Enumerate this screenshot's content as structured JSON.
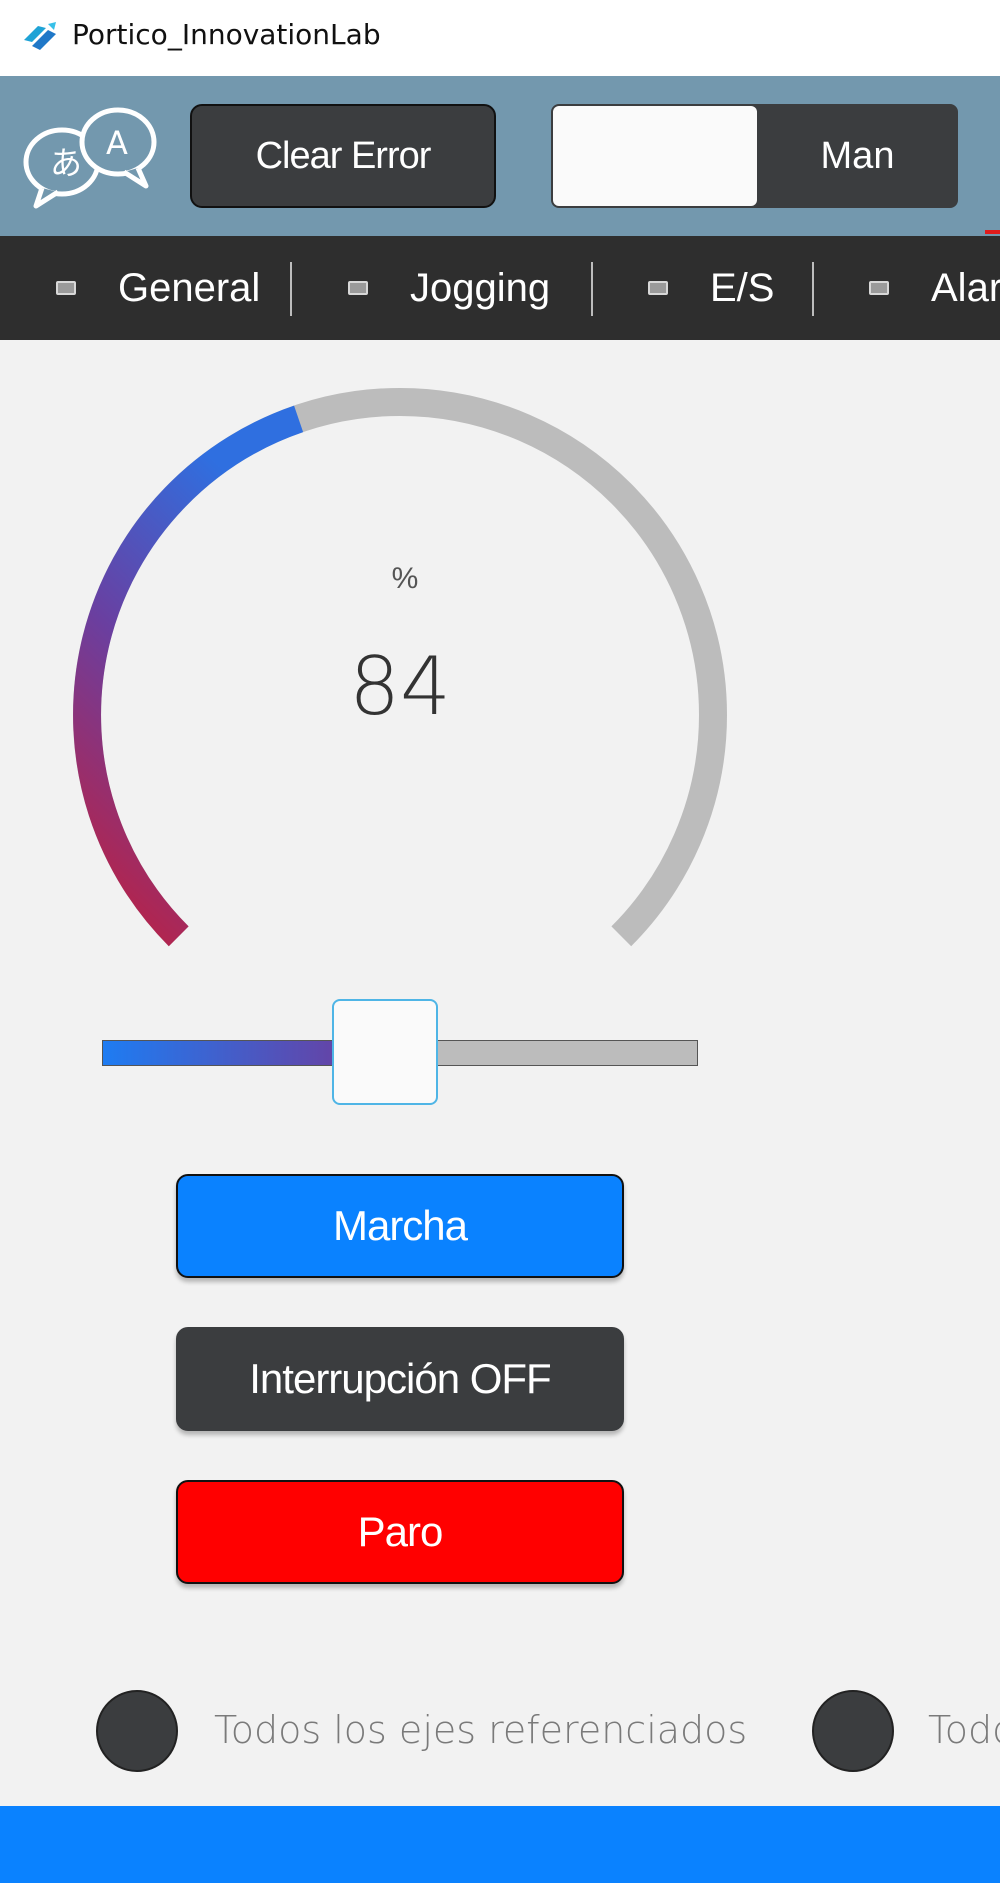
{
  "window": {
    "title": "Portico_InnovationLab"
  },
  "header": {
    "clear_error_label": "Clear Error",
    "mode_label": "Man"
  },
  "tabs": [
    {
      "label": "General"
    },
    {
      "label": "Jogging"
    },
    {
      "label": "E/S"
    },
    {
      "label": "Alar"
    }
  ],
  "gauge": {
    "unit": "%",
    "value": "84",
    "fraction": 0.43,
    "gradient_colors": [
      "#c41e3a",
      "#6a3fa0",
      "#2f6fe0"
    ],
    "track_color": "#bcbcbc"
  },
  "slider": {
    "fraction": 0.43
  },
  "buttons": {
    "marcha": "Marcha",
    "interrupt": "Interrupción OFF",
    "paro": "Paro"
  },
  "status": [
    {
      "label": "Todos los ejes referenciados"
    },
    {
      "label": "Todo"
    }
  ],
  "colors": {
    "header": "#7398ae",
    "tabs_bg": "#2e2e2e",
    "primary_blue": "#0a82ff",
    "stop_red": "#ff0000",
    "dark_button": "#3b3d3f"
  }
}
